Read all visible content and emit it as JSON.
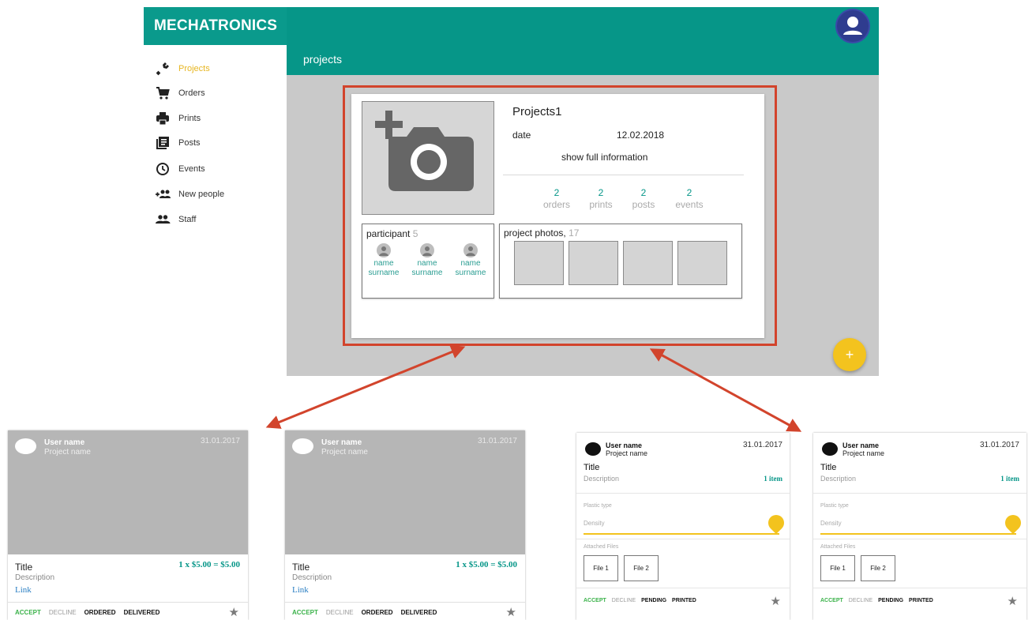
{
  "app": {
    "brand": "MECHATRONICS",
    "page_label": "projects"
  },
  "sidebar": {
    "items": [
      {
        "label": "Projects",
        "icon": "wrench-icon",
        "active": true
      },
      {
        "label": "Orders",
        "icon": "cart-icon"
      },
      {
        "label": "Prints",
        "icon": "printer-icon"
      },
      {
        "label": "Posts",
        "icon": "posts-icon"
      },
      {
        "label": "Events",
        "icon": "clock-icon"
      },
      {
        "label": "New people",
        "icon": "add-people-icon"
      },
      {
        "label": "Staff",
        "icon": "people-icon"
      }
    ]
  },
  "project": {
    "title": "Projects1",
    "date_label": "date",
    "date_value": "12.02.2018",
    "show_full": "show full information",
    "stats": [
      {
        "n": "2",
        "label": "orders"
      },
      {
        "n": "2",
        "label": "prints"
      },
      {
        "n": "2",
        "label": "posts"
      },
      {
        "n": "2",
        "label": "events"
      }
    ],
    "participants_label": "participant",
    "participants_count": "5",
    "participants": [
      {
        "first": "name",
        "last": "surname"
      },
      {
        "first": "name",
        "last": "surname"
      },
      {
        "first": "name",
        "last": "surname"
      }
    ],
    "photos_label": "project photos,",
    "photos_count": "17"
  },
  "fab": {
    "symbol": "+"
  },
  "order_cards": [
    {
      "user": "User name",
      "project": "Project name",
      "date": "31.01.2017",
      "title": "Title",
      "description": "Description",
      "link": "Link",
      "price": "1 x $5.00 = $5.00",
      "actions": [
        "ACCEPT",
        "DECLINE",
        "ORDERED",
        "DELIVERED"
      ]
    },
    {
      "user": "User name",
      "project": "Project name",
      "date": "31.01.2017",
      "title": "Title",
      "description": "Description",
      "link": "Link",
      "price": "1 x $5.00 = $5.00",
      "actions": [
        "ACCEPT",
        "DECLINE",
        "ORDERED",
        "DELIVERED"
      ]
    }
  ],
  "print_cards": [
    {
      "user": "User name",
      "project": "Project name",
      "date": "31.01.2017",
      "title": "Title",
      "description": "Description",
      "items": "1 item",
      "plastic_label": "Plastic type",
      "density_label": "Density",
      "attached_label": "Attached Files",
      "files": [
        "File 1",
        "File 2"
      ],
      "actions": [
        "ACCEPT",
        "DECLINE",
        "PENDING",
        "PRINTED"
      ]
    },
    {
      "user": "User name",
      "project": "Project name",
      "date": "31.01.2017",
      "title": "Title",
      "description": "Description",
      "items": "1 item",
      "plastic_label": "Plastic type",
      "density_label": "Density",
      "attached_label": "Attached Files",
      "files": [
        "File 1",
        "File 2"
      ],
      "actions": [
        "ACCEPT",
        "DECLINE",
        "PENDING",
        "PRINTED"
      ]
    }
  ],
  "colors": {
    "teal": "#069688",
    "accent_yellow": "#f3c31e",
    "highlight_red": "#d2442c",
    "accept_green": "#3bb24a"
  }
}
